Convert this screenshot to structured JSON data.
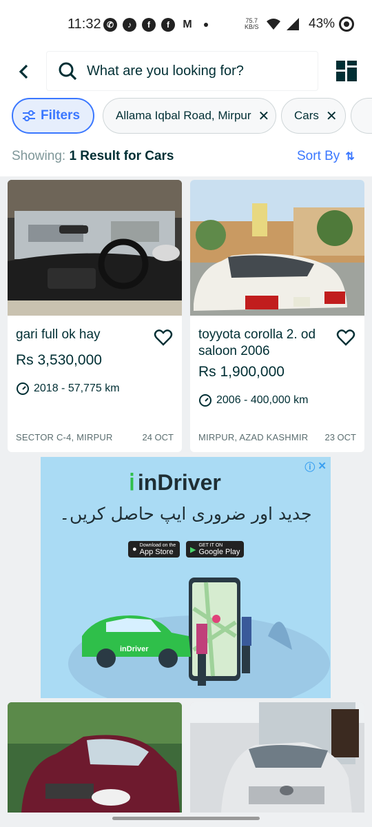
{
  "status_bar": {
    "time": "11:32",
    "net_speed_top": "75.7",
    "net_speed_bottom": "KB/S",
    "battery": "43%",
    "icons": [
      "whatsapp-icon",
      "tiktok-icon",
      "facebook-icon",
      "facebook-icon",
      "gmail-icon"
    ]
  },
  "header": {
    "search_placeholder": "What are you looking for?"
  },
  "filters": {
    "filters_label": "Filters",
    "chips": [
      {
        "label": "Allama Iqbal Road, Mirpur"
      },
      {
        "label": "Cars"
      }
    ]
  },
  "results": {
    "showing_label": "Showing:",
    "showing_value": "1 Result for Cars",
    "sort_label": "Sort By"
  },
  "listings": [
    {
      "title": "gari full ok hay",
      "price": "Rs 3,530,000",
      "meta": "2018 - 57,775 km",
      "location": "SECTOR C-4, MIRPUR",
      "date": "24 OCT"
    },
    {
      "title": "toyyota corolla 2. od saloon 2006",
      "price": "Rs 1,900,000",
      "meta": "2006 - 400,000 km",
      "location": "MIRPUR, AZAD KASHMIR",
      "date": "23 OCT"
    }
  ],
  "ad": {
    "brand": "inDriver",
    "urdu_text": "جدید اور ضروری ایپ حاصل کریں۔",
    "app_store_small": "Download on the",
    "app_store": "App Store",
    "google_play_small": "GET IT ON",
    "google_play": "Google Play",
    "car_brand": "inDriver"
  },
  "colors": {
    "accent": "#3a77ff",
    "text": "#002f34",
    "ad_background": "#aadbf4"
  }
}
